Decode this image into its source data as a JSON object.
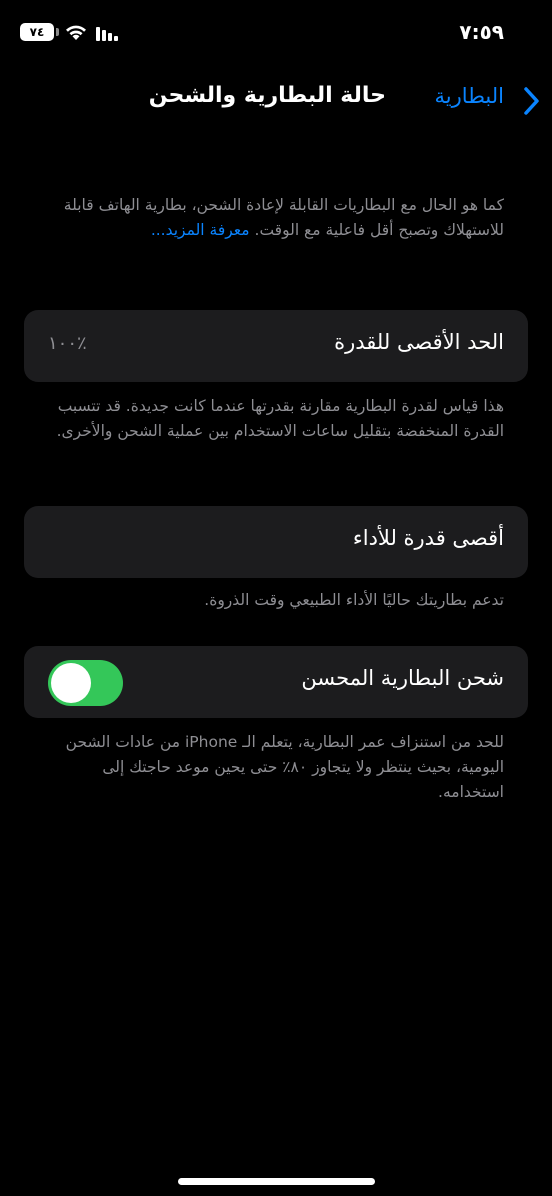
{
  "status_bar": {
    "time": "٧:٥٩",
    "battery_level": "٧٤"
  },
  "nav": {
    "back_label": "البطارية",
    "title": "حالة البطارية والشحن"
  },
  "intro": {
    "text": "كما هو الحال مع البطاريات القابلة لإعادة الشحن، بطارية الهاتف قابلة للاستهلاك وتصبح أقل فاعلية مع الوقت.",
    "learn_more": "معرفة المزيد..."
  },
  "max_capacity": {
    "label": "الحد الأقصى للقدرة",
    "value": "٪١٠٠",
    "description": "هذا قياس لقدرة البطارية مقارنة بقدرتها عندما كانت جديدة. قد تتسبب القدرة المنخفضة بتقليل ساعات الاستخدام بين عملية الشحن والأخرى."
  },
  "peak_performance": {
    "label": "أقصى قدرة للأداء",
    "description": "تدعم بطاريتك حاليًا الأداء الطبيعي وقت الذروة."
  },
  "optimized_charging": {
    "label": "شحن البطارية المحسن",
    "enabled": true,
    "description": "للحد من استنزاف عمر البطارية، يتعلم الـ iPhone من عادات الشحن اليومية، بحيث ينتظر ولا يتجاوز ٨٠٪ حتى يحين موعد حاجتك إلى استخدامه."
  },
  "colors": {
    "accent": "#0a84ff",
    "toggle_on": "#34c759",
    "card_bg": "#1c1c1e",
    "secondary_text": "#8e8e93"
  }
}
